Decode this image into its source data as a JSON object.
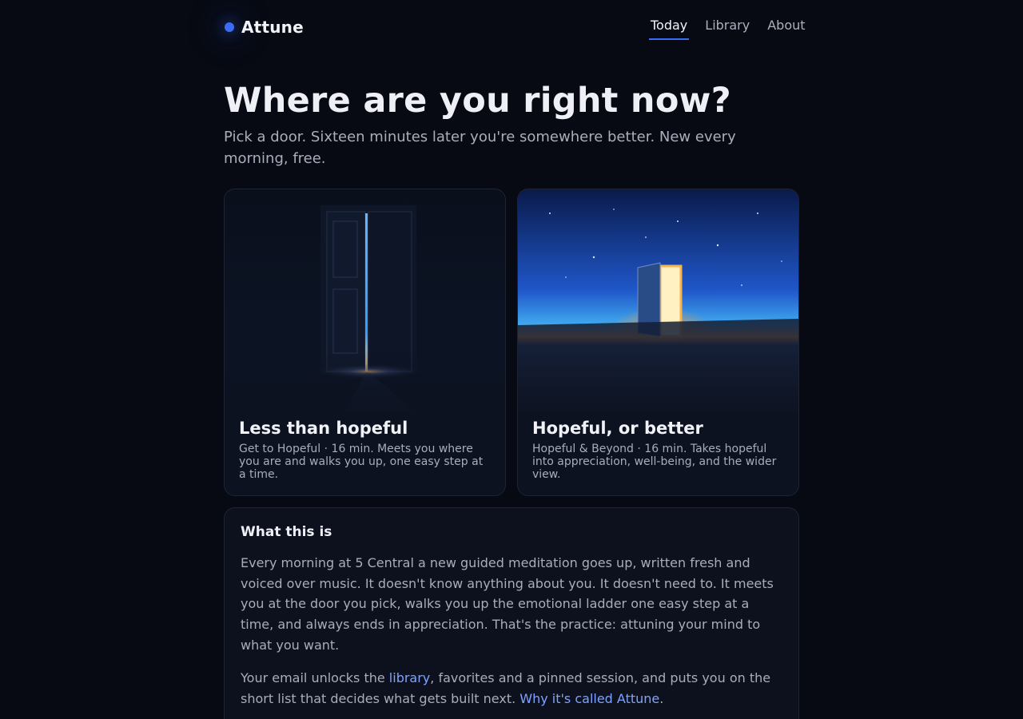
{
  "header": {
    "brand": "Attune",
    "nav": [
      {
        "label": "Today",
        "active": true
      },
      {
        "label": "Library",
        "active": false
      },
      {
        "label": "About",
        "active": false
      }
    ]
  },
  "hero": {
    "title": "Where are you right now?",
    "subtitle": "Pick a door. Sixteen minutes later you're somewhere better. New every morning, free."
  },
  "doors": [
    {
      "title": "Less than hopeful",
      "description": "Get to Hopeful · 16 min. Meets you where you are and walks you up, one easy step at a time."
    },
    {
      "title": "Hopeful, or better",
      "description": "Hopeful & Beyond · 16 min. Takes hopeful into appreciation, well-being, and the wider view."
    }
  ],
  "info": {
    "title": "What this is",
    "paragraph1": "Every morning at 5 Central a new guided meditation goes up, written fresh and voiced over music. It doesn't know anything about you. It doesn't need to. It meets you at the door you pick, walks you up the emotional ladder one easy step at a time, and always ends in appreciation. That's the practice: attuning your mind to what you want.",
    "p2_before": "Your email unlocks the ",
    "p2_link1": "library",
    "p2_middle": ", favorites and a pinned session, and puts you on the short list that decides what gets built next. ",
    "p2_link2": "Why it's called Attune",
    "p2_end": "."
  },
  "colors": {
    "background": "#070a12",
    "accent": "#3b6cf6",
    "link": "#7ea2ff",
    "card": "#0d1220"
  }
}
